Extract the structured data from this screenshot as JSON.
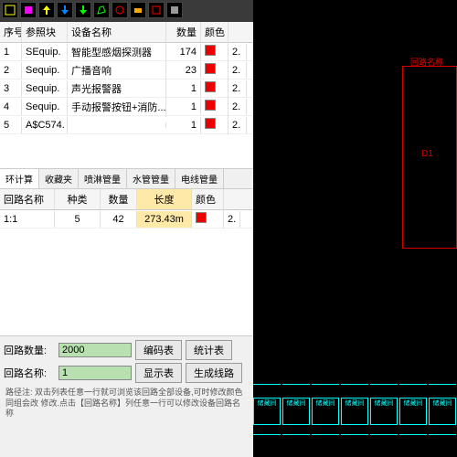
{
  "toolbar": {
    "icons": [
      "layer-icon",
      "square-icon",
      "arrow-up-icon",
      "down-icon",
      "arrow-down-icon",
      "poly-icon",
      "circle-icon",
      "block-icon",
      "outline-icon",
      "fill-icon"
    ]
  },
  "table1": {
    "headers": {
      "idx": "序号",
      "ref": "参照块",
      "name": "设备名称",
      "qty": "数量",
      "color": "颜色"
    },
    "rows": [
      {
        "idx": "1",
        "ref": "SEquip.",
        "name": "智能型感烟探测器",
        "qty": "174",
        "ext": "2."
      },
      {
        "idx": "2",
        "ref": "Sequip.",
        "name": "广播音响",
        "qty": "23",
        "ext": "2."
      },
      {
        "idx": "3",
        "ref": "Sequip.",
        "name": "声光报警器",
        "qty": "1",
        "ext": "2."
      },
      {
        "idx": "4",
        "ref": "Sequip.",
        "name": "手动报警按钮+消防...",
        "qty": "1",
        "ext": "2."
      },
      {
        "idx": "5",
        "ref": "A$C574.",
        "name": "",
        "qty": "1",
        "ext": "2."
      }
    ]
  },
  "tabs": {
    "items": [
      "环计算",
      "收藏夹",
      "喷淋管量",
      "水管管量",
      "电线管量"
    ],
    "active": 0
  },
  "table2": {
    "headers": {
      "name": "回路名称",
      "type": "种类",
      "qty": "数量",
      "len": "长度",
      "color": "颜色"
    },
    "rows": [
      {
        "name": "1:1",
        "type": "5",
        "qty": "42",
        "len": "273.43m",
        "ext": "2."
      }
    ]
  },
  "form": {
    "count_label": "回路数量:",
    "count_value": "2000",
    "name_label": "回路名称:",
    "name_value": "1",
    "btn_code": "编码表",
    "btn_stat": "统计表",
    "btn_show": "显示表",
    "btn_gen": "生成线路"
  },
  "hint": "路径注:\n双击列表任意一行就可浏览该回路全部设备,可时修改颜色同组会改\n修改.点击【回路名称】列任意一行可以修改设备回路名称",
  "cad": {
    "box_label": "回路名称",
    "box_text": "D1",
    "rooms": [
      "储藏间",
      "储藏间",
      "储藏间",
      "储藏间",
      "储藏间",
      "储藏间",
      "储藏间"
    ]
  }
}
